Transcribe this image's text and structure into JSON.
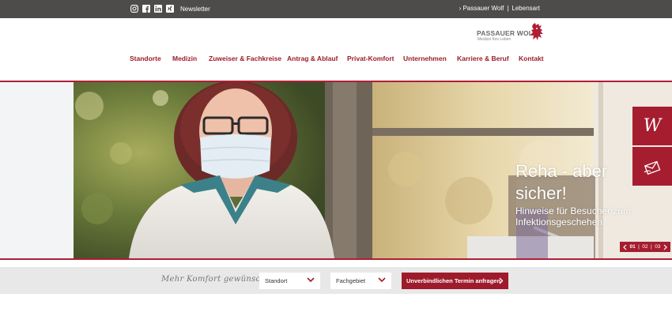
{
  "topbar": {
    "social_icons": [
      "instagram-icon",
      "facebook-icon",
      "linkedin-icon",
      "xing-icon"
    ],
    "newsletter": "Newsletter",
    "links": [
      {
        "label": "› Passauer Wolf"
      },
      {
        "label": "|"
      },
      {
        "label": "Lebensart"
      }
    ]
  },
  "logo": {
    "name": "PASSAUER WOLF",
    "tagline": "Medizin fürs Leben"
  },
  "nav": {
    "items": [
      {
        "label": "Standorte"
      },
      {
        "label": "Medizin"
      },
      {
        "label": "Zuweiser & Fachkreise"
      },
      {
        "label": "Antrag & Ablauf"
      },
      {
        "label": "Privat-Komfort"
      },
      {
        "label": "Unternehmen"
      },
      {
        "label": "Karriere & Beruf"
      },
      {
        "label": "Kontakt"
      }
    ]
  },
  "hero": {
    "title": "Reha - aber sicher!",
    "subtitle": "Hinweise für Besucher zum Infektionsgeschehen",
    "side_buttons": [
      {
        "icon": "w-script-icon",
        "symbol": "W"
      },
      {
        "icon": "mail-icon"
      }
    ],
    "pager": {
      "prev_icon": "chevron-left-icon",
      "next_icon": "chevron-right-icon",
      "pages": [
        "01",
        "02",
        "03"
      ],
      "separator": "|",
      "active_page": "01"
    }
  },
  "search": {
    "label": "Mehr Komfort gewünscht?",
    "location_select": "Standort",
    "field_select": "Fachgebiet",
    "cta": "Unverbindlichen Termin anfragen"
  },
  "colors": {
    "topbar": "#4d4c4a",
    "brand_red": "#9e1b2c",
    "strip": "#e8e8e8"
  }
}
